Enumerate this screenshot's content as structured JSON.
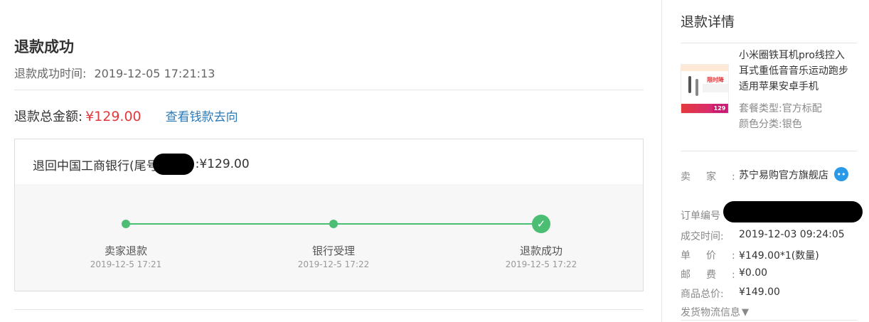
{
  "main": {
    "title": "退款成功",
    "success_time_label": "退款成功时间:",
    "success_time": "2019-12-05 17:21:13",
    "total_label": "退款总金额:",
    "total_amount": "¥129.00",
    "track_link": "查看钱款去向",
    "bank_prefix": "退回中国工商银行(尾号",
    "bank_suffix": ":¥129.00",
    "steps": [
      {
        "label": "卖家退款",
        "date": "2019-12-5 17:21"
      },
      {
        "label": "银行受理",
        "date": "2019-12-5 17:22"
      },
      {
        "label": "退款成功",
        "date": "2019-12-5 17:22"
      }
    ],
    "progress_color": "#4cbe73",
    "accent_red": "#e4393c",
    "link_color": "#2a7ab8"
  },
  "side": {
    "title": "退款详情",
    "product_name": "小米圈铁耳机pro线控入耳式重低音音乐运动跑步适用苹果安卓手机",
    "thumb": {
      "promo": "限时降20元",
      "price": "129"
    },
    "package_type": "套餐类型:官方标配",
    "color": "颜色分类:银色",
    "seller_label": "卖家:",
    "seller_name": "苏宁易购官方旗舰店",
    "order_no_label": "订单编号",
    "deal_time_label": "成交时间:",
    "deal_time": "2019-12-03 09:24:05",
    "unit_price_label": "单价:",
    "unit_price": "¥149.00*1(数量)",
    "postage_label": "邮费:",
    "postage": "¥0.00",
    "total_label": "商品总价:",
    "total": "¥149.00",
    "logistics_label": "发货物流信息"
  }
}
